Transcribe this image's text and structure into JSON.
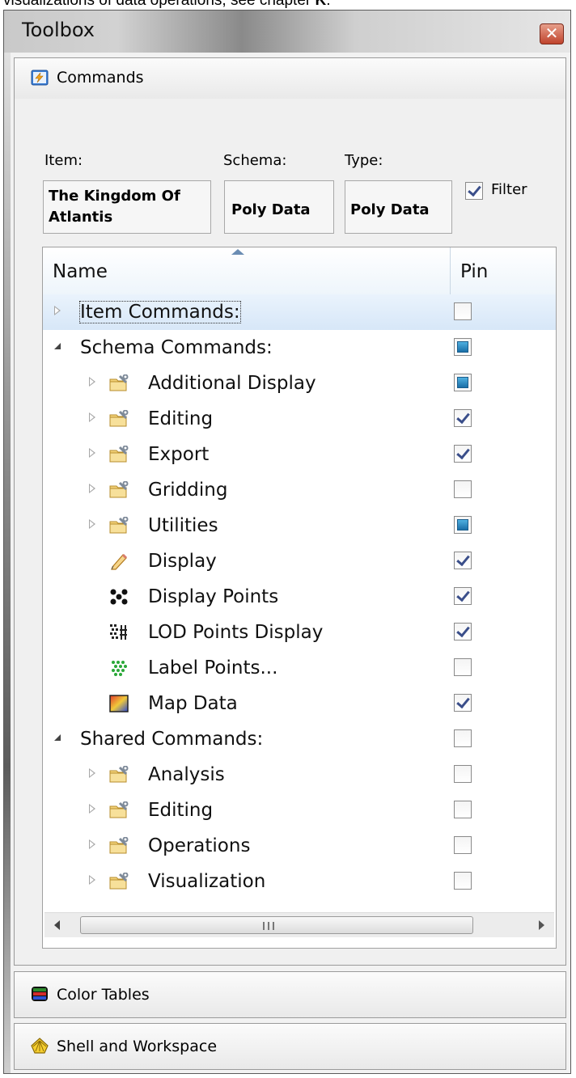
{
  "caption": {
    "prefix": "visualizations of data operations, see chapter ",
    "bold": "K",
    "suffix": "."
  },
  "window": {
    "title": "Toolbox",
    "close_glyph": "✕"
  },
  "sections": {
    "commands": {
      "label": "Commands",
      "icon": "lightning-panel-icon"
    },
    "color_tables": {
      "label": "Color Tables",
      "icon": "color-table-icon"
    },
    "shell_workspace": {
      "label": "Shell and Workspace",
      "icon": "shell-icon"
    }
  },
  "filters": {
    "item_label": "Item:",
    "schema_label": "Schema:",
    "type_label": "Type:",
    "item_value_line1": "The Kingdom Of",
    "item_value_line2": "Atlantis",
    "schema_value": "Poly Data",
    "type_value": "Poly Data",
    "filter_label": "Filter",
    "filter_checked": true
  },
  "grid": {
    "columns": {
      "name": "Name",
      "pin": "Pin"
    },
    "rows": [
      {
        "label": "Item Commands:",
        "level": 0,
        "expander": "collapsed",
        "icon": null,
        "pin": "unchecked",
        "selected": true
      },
      {
        "label": "Schema Commands:",
        "level": 0,
        "expander": "expanded",
        "icon": null,
        "pin": "indeterminate"
      },
      {
        "label": "Additional Display",
        "level": 1,
        "expander": "collapsed",
        "icon": "folder-wrench-icon",
        "pin": "indeterminate"
      },
      {
        "label": "Editing",
        "level": 1,
        "expander": "collapsed",
        "icon": "folder-wrench-icon",
        "pin": "checked"
      },
      {
        "label": "Export",
        "level": 1,
        "expander": "collapsed",
        "icon": "folder-wrench-icon",
        "pin": "checked"
      },
      {
        "label": "Gridding",
        "level": 1,
        "expander": "collapsed",
        "icon": "folder-wrench-icon",
        "pin": "unchecked"
      },
      {
        "label": "Utilities",
        "level": 1,
        "expander": "collapsed",
        "icon": "folder-wrench-icon",
        "pin": "indeterminate"
      },
      {
        "label": "Display",
        "level": 1,
        "expander": null,
        "icon": "pencil-icon",
        "pin": "checked"
      },
      {
        "label": "Display Points",
        "level": 1,
        "expander": null,
        "icon": "points-icon",
        "pin": "checked"
      },
      {
        "label": "LOD Points Display",
        "level": 1,
        "expander": null,
        "icon": "lod-points-icon",
        "pin": "checked"
      },
      {
        "label": "Label Points...",
        "level": 1,
        "expander": null,
        "icon": "label-points-icon",
        "pin": "unchecked"
      },
      {
        "label": "Map Data",
        "level": 1,
        "expander": null,
        "icon": "map-data-icon",
        "pin": "checked"
      },
      {
        "label": "Shared Commands:",
        "level": 0,
        "expander": "expanded",
        "icon": null,
        "pin": "unchecked"
      },
      {
        "label": "Analysis",
        "level": 1,
        "expander": "collapsed",
        "icon": "folder-wrench-icon",
        "pin": "unchecked"
      },
      {
        "label": "Editing",
        "level": 1,
        "expander": "collapsed",
        "icon": "folder-wrench-icon",
        "pin": "unchecked"
      },
      {
        "label": "Operations",
        "level": 1,
        "expander": "collapsed",
        "icon": "folder-wrench-icon",
        "pin": "unchecked"
      },
      {
        "label": "Visualization",
        "level": 1,
        "expander": "collapsed",
        "icon": "folder-wrench-icon",
        "pin": "unchecked"
      }
    ]
  },
  "scrollbar": {
    "grip": "III"
  }
}
